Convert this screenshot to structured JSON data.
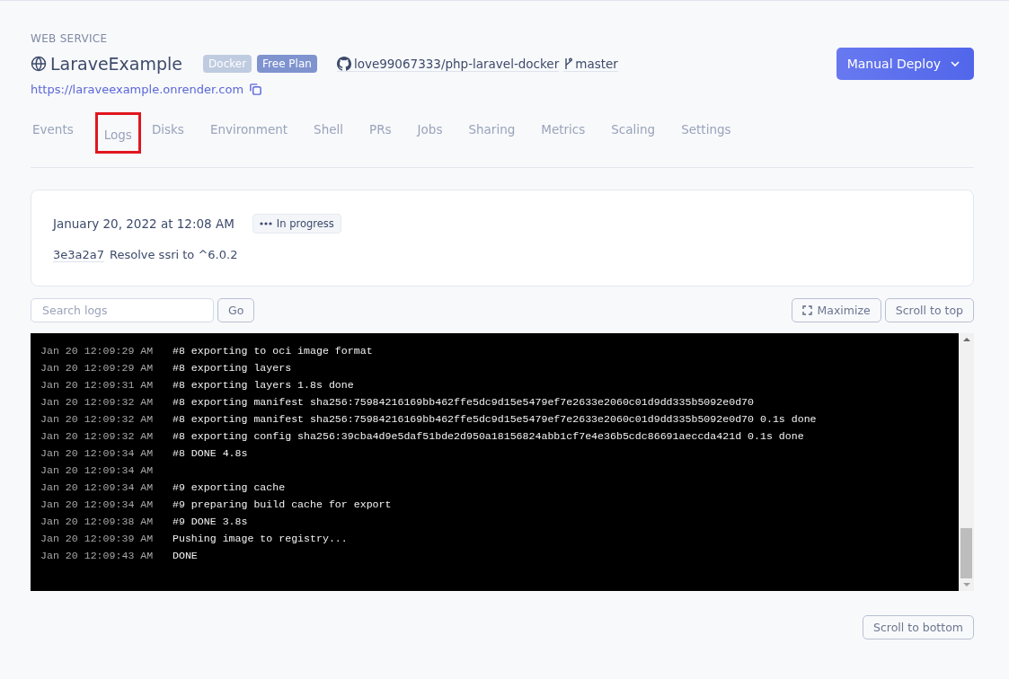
{
  "service": {
    "kind_label": "WEB SERVICE",
    "name": "LaraveExample",
    "badges": [
      {
        "label": "Docker",
        "color": "#bfcbe0"
      },
      {
        "label": "Free Plan",
        "color": "#7f93cf"
      }
    ],
    "repo": "love99067333/php-laravel-docker",
    "branch": "master",
    "url": "https://laraveexample.onrender.com"
  },
  "deploy_button": {
    "label": "Manual Deploy"
  },
  "tabs": [
    {
      "label": "Events",
      "annotated": false
    },
    {
      "label": "Logs",
      "annotated": true
    },
    {
      "label": "Disks",
      "annotated": false
    },
    {
      "label": "Environment",
      "annotated": false
    },
    {
      "label": "Shell",
      "annotated": false
    },
    {
      "label": "PRs",
      "annotated": false
    },
    {
      "label": "Jobs",
      "annotated": false
    },
    {
      "label": "Sharing",
      "annotated": false
    },
    {
      "label": "Metrics",
      "annotated": false
    },
    {
      "label": "Scaling",
      "annotated": false
    },
    {
      "label": "Settings",
      "annotated": false
    }
  ],
  "deploy": {
    "date": "January 20, 2022 at 12:08 AM",
    "status": "In progress",
    "commit": "3e3a2a7",
    "message": "Resolve ssri to ^6.0.2"
  },
  "log_toolbar": {
    "search": {
      "placeholder": "Search logs"
    },
    "go": "Go",
    "maximize": "Maximize",
    "scroll_top": "Scroll to top"
  },
  "logs": [
    {
      "time": "Jan 20 12:09:29 AM",
      "text": "#8 exporting to oci image format"
    },
    {
      "time": "Jan 20 12:09:29 AM",
      "text": "#8 exporting layers"
    },
    {
      "time": "Jan 20 12:09:31 AM",
      "text": "#8 exporting layers 1.8s done"
    },
    {
      "time": "Jan 20 12:09:32 AM",
      "text": "#8 exporting manifest sha256:75984216169bb462ffe5dc9d15e5479ef7e2633e2060c01d9dd335b5092e0d70"
    },
    {
      "time": "Jan 20 12:09:32 AM",
      "text": "#8 exporting manifest sha256:75984216169bb462ffe5dc9d15e5479ef7e2633e2060c01d9dd335b5092e0d70 0.1s done"
    },
    {
      "time": "Jan 20 12:09:32 AM",
      "text": "#8 exporting config sha256:39cba4d9e5daf51bde2d950a18156824abb1cf7e4e36b5cdc86691aeccda421d 0.1s done"
    },
    {
      "time": "Jan 20 12:09:34 AM",
      "text": "#8 DONE 4.8s"
    },
    {
      "time": "Jan 20 12:09:34 AM"
    },
    {
      "time": "Jan 20 12:09:34 AM",
      "text": "#9 exporting cache"
    },
    {
      "time": "Jan 20 12:09:34 AM",
      "text": "#9 preparing build cache for export"
    },
    {
      "time": "Jan 20 12:09:38 AM",
      "text": "#9 DONE 3.8s"
    },
    {
      "time": "Jan 20 12:09:39 AM",
      "text": "Pushing image to registry..."
    },
    {
      "time": "Jan 20 12:09:43 AM",
      "text": "DONE"
    }
  ],
  "scroll_bottom": "Scroll to bottom"
}
